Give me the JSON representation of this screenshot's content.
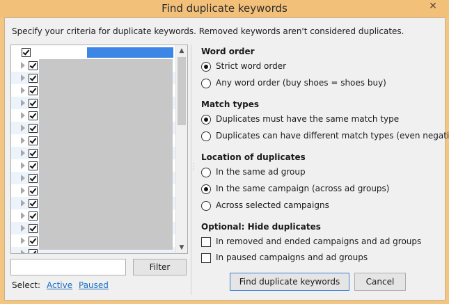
{
  "window": {
    "title": "Find duplicate keywords",
    "close_glyph": "✕"
  },
  "intro": "Specify your criteria for duplicate keywords. Removed keywords aren't considered duplicates.",
  "filter": {
    "button_label": "Filter",
    "input_value": ""
  },
  "select": {
    "label": "Select:",
    "active_label": "Active",
    "paused_label": "Paused"
  },
  "sections": {
    "word_order": {
      "title": "Word order",
      "options": [
        "Strict word order",
        "Any word order (buy shoes = shoes buy)"
      ],
      "selected": 0
    },
    "match_types": {
      "title": "Match types",
      "options": [
        "Duplicates must have the same match type",
        "Duplicates can have different match types (even negatives)"
      ],
      "selected": 0
    },
    "location": {
      "title": "Location of duplicates",
      "options": [
        "In the same ad group",
        "In the same campaign (across ad groups)",
        "Across selected campaigns"
      ],
      "selected": 1
    },
    "hide": {
      "title": "Optional: Hide duplicates",
      "options": [
        "In removed and ended campaigns and ad groups",
        "In paused campaigns and ad groups"
      ]
    }
  },
  "buttons": {
    "find_label": "Find duplicate keywords",
    "cancel_label": "Cancel"
  }
}
